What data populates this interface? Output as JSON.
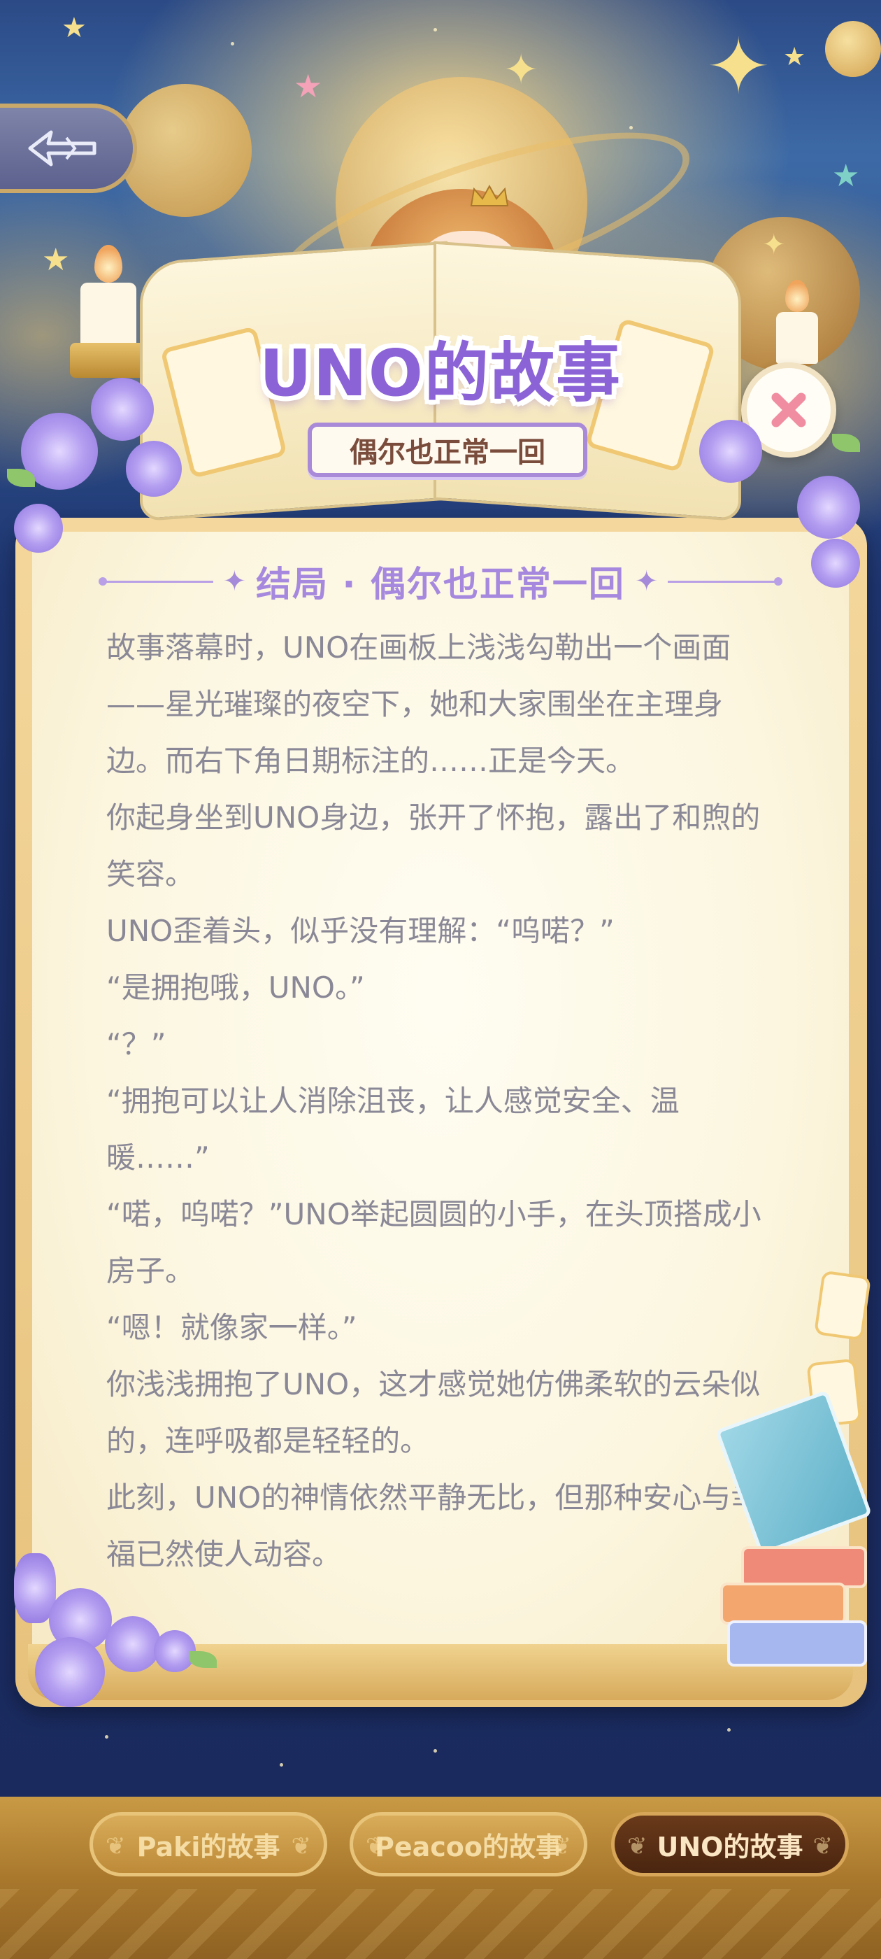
{
  "header": {
    "title": "UNO的故事",
    "subtitle": "偶尔也正常一回"
  },
  "chapter": {
    "heading": "结局 · 偶尔也正常一回"
  },
  "story": {
    "paragraphs": [
      "故事落幕时，UNO在画板上浅浅勾勒出一个画面——星光璀璨的夜空下，她和大家围坐在主理身边。而右下角日期标注的……正是今天。",
      "你起身坐到UNO身边，张开了怀抱，露出了和煦的笑容。",
      "UNO歪着头，似乎没有理解：“呜喏？”",
      "“是拥抱哦，UNO。”",
      "“？”",
      "“拥抱可以让人消除沮丧，让人感觉安全、温暖……”",
      "“喏，呜喏？”UNO举起圆圆的小手，在头顶搭成小房子。",
      "“嗯！就像家一样。”",
      "你浅浅拥抱了UNO，这才感觉她仿佛柔软的云朵似的，连呼吸都是轻轻的。",
      "此刻，UNO的神情依然平静无比，但那种安心与幸福已然使人动容。"
    ]
  },
  "tabs": [
    {
      "label": "Paki的故事",
      "active": false
    },
    {
      "label": "Peacoo的故事",
      "active": false
    },
    {
      "label": "UNO的故事",
      "active": true
    }
  ],
  "icons": {
    "back": "back-arrow-icon",
    "close": "close-icon"
  },
  "colors": {
    "title": "#8b63d6",
    "chapter": "#a689de",
    "body_text": "#8a8896",
    "close_x": "#f08da0",
    "active_tab": "#4a2510"
  }
}
